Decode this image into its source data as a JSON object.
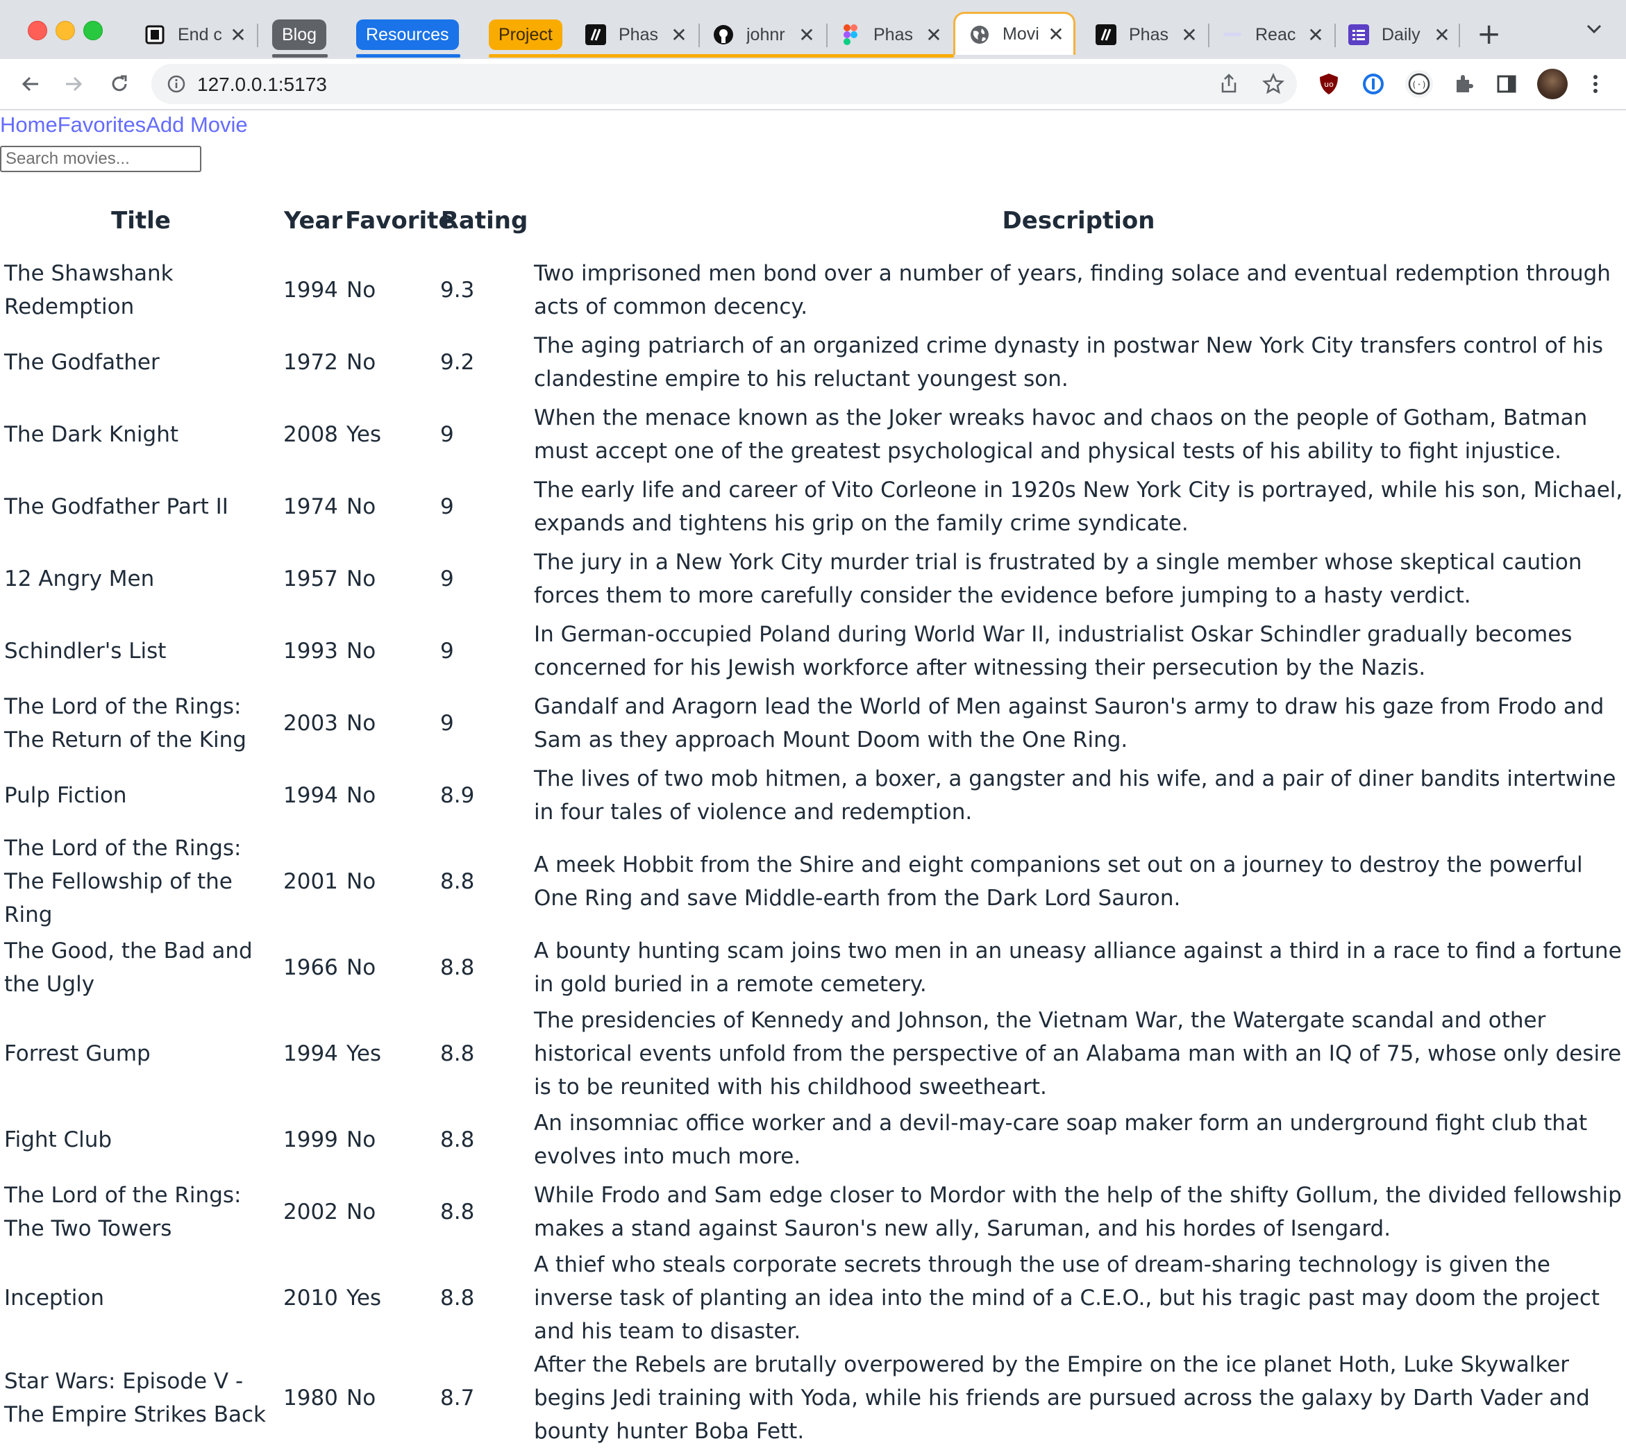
{
  "browser": {
    "tabs": [
      {
        "title": "End c",
        "icon": "notion-icon"
      },
      {
        "title": "Phas",
        "icon": "linear-icon"
      },
      {
        "title": "johnr",
        "icon": "github-icon"
      },
      {
        "title": "Phas",
        "icon": "figma-icon"
      },
      {
        "title": "Movi",
        "icon": "globe-icon",
        "active": true
      },
      {
        "title": "Phas",
        "icon": "linear-icon"
      },
      {
        "title": "Reac",
        "icon": "react-icon"
      },
      {
        "title": "Daily",
        "icon": "daily-icon"
      }
    ],
    "tab_groups": [
      {
        "label": "Blog",
        "color": "#5f6368"
      },
      {
        "label": "Resources",
        "color": "#1a73e8"
      },
      {
        "label": "Project",
        "color": "#f9ab00"
      }
    ],
    "url": "127.0.0.1:5173"
  },
  "nav": {
    "links": [
      "Home",
      "Favorites",
      "Add Movie"
    ]
  },
  "search": {
    "placeholder": "Search movies..."
  },
  "table": {
    "headers": {
      "title": "Title",
      "year": "Year",
      "favorite": "Favorite",
      "rating": "Rating",
      "description": "Description"
    },
    "rows": [
      {
        "title": "The Shawshank Redemption",
        "year": "1994",
        "favorite": "No",
        "rating": "9.3",
        "description": "Two imprisoned men bond over a number of years, finding solace and eventual redemption through acts of common decency."
      },
      {
        "title": "The Godfather",
        "year": "1972",
        "favorite": "No",
        "rating": "9.2",
        "description": "The aging patriarch of an organized crime dynasty in postwar New York City transfers control of his clandestine empire to his reluctant youngest son."
      },
      {
        "title": "The Dark Knight",
        "year": "2008",
        "favorite": "Yes",
        "rating": "9",
        "description": "When the menace known as the Joker wreaks havoc and chaos on the people of Gotham, Batman must accept one of the greatest psychological and physical tests of his ability to fight injustice."
      },
      {
        "title": "The Godfather Part II",
        "year": "1974",
        "favorite": "No",
        "rating": "9",
        "description": "The early life and career of Vito Corleone in 1920s New York City is portrayed, while his son, Michael, expands and tightens his grip on the family crime syndicate."
      },
      {
        "title": "12 Angry Men",
        "year": "1957",
        "favorite": "No",
        "rating": "9",
        "description": "The jury in a New York City murder trial is frustrated by a single member whose skeptical caution forces them to more carefully consider the evidence before jumping to a hasty verdict."
      },
      {
        "title": "Schindler's List",
        "year": "1993",
        "favorite": "No",
        "rating": "9",
        "description": "In German-occupied Poland during World War II, industrialist Oskar Schindler gradually becomes concerned for his Jewish workforce after witnessing their persecution by the Nazis."
      },
      {
        "title": "The Lord of the Rings: The Return of the King",
        "year": "2003",
        "favorite": "No",
        "rating": "9",
        "description": "Gandalf and Aragorn lead the World of Men against Sauron's army to draw his gaze from Frodo and Sam as they approach Mount Doom with the One Ring."
      },
      {
        "title": "Pulp Fiction",
        "year": "1994",
        "favorite": "No",
        "rating": "8.9",
        "description": "The lives of two mob hitmen, a boxer, a gangster and his wife, and a pair of diner bandits intertwine in four tales of violence and redemption."
      },
      {
        "title": "The Lord of the Rings: The Fellowship of the Ring",
        "year": "2001",
        "favorite": "No",
        "rating": "8.8",
        "description": "A meek Hobbit from the Shire and eight companions set out on a journey to destroy the powerful One Ring and save Middle-earth from the Dark Lord Sauron."
      },
      {
        "title": "The Good, the Bad and the Ugly",
        "year": "1966",
        "favorite": "No",
        "rating": "8.8",
        "description": "A bounty hunting scam joins two men in an uneasy alliance against a third in a race to find a fortune in gold buried in a remote cemetery."
      },
      {
        "title": "Forrest Gump",
        "year": "1994",
        "favorite": "Yes",
        "rating": "8.8",
        "description": "The presidencies of Kennedy and Johnson, the Vietnam War, the Watergate scandal and other historical events unfold from the perspective of an Alabama man with an IQ of 75, whose only desire is to be reunited with his childhood sweetheart."
      },
      {
        "title": "Fight Club",
        "year": "1999",
        "favorite": "No",
        "rating": "8.8",
        "description": "An insomniac office worker and a devil-may-care soap maker form an underground fight club that evolves into much more."
      },
      {
        "title": "The Lord of the Rings: The Two Towers",
        "year": "2002",
        "favorite": "No",
        "rating": "8.8",
        "description": "While Frodo and Sam edge closer to Mordor with the help of the shifty Gollum, the divided fellowship makes a stand against Sauron's new ally, Saruman, and his hordes of Isengard."
      },
      {
        "title": "Inception",
        "year": "2010",
        "favorite": "Yes",
        "rating": "8.8",
        "description": "A thief who steals corporate secrets through the use of dream-sharing technology is given the inverse task of planting an idea into the mind of a C.E.O., but his tragic past may doom the project and his team to disaster."
      },
      {
        "title": "Star Wars: Episode V - The Empire Strikes Back",
        "year": "1980",
        "favorite": "No",
        "rating": "8.7",
        "description": "After the Rebels are brutally overpowered by the Empire on the ice planet Hoth, Luke Skywalker begins Jedi training with Yoda, while his friends are pursued across the galaxy by Darth Vader and bounty hunter Boba Fett."
      }
    ]
  },
  "colors": {
    "link": "#646cff",
    "text": "#1f2b38",
    "active_tab_border": "#f4b23e"
  }
}
